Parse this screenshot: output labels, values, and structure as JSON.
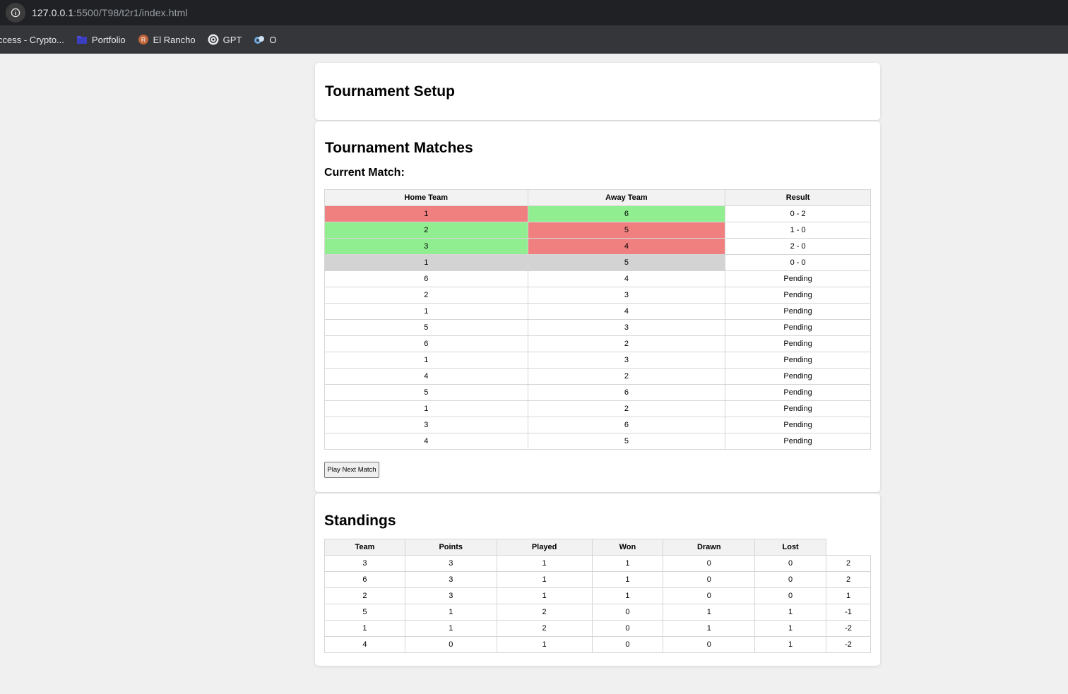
{
  "browser": {
    "url_host": "127.0.0.1",
    "url_rest": ":5500/T98/t2r1/index.html",
    "bookmarks": [
      {
        "label": "ccess - Crypto...",
        "icon": ""
      },
      {
        "label": "Portfolio",
        "icon": "folder-icon"
      },
      {
        "label": "El Rancho",
        "icon": "rancho-icon"
      },
      {
        "label": "GPT",
        "icon": "openai-icon"
      },
      {
        "label": "O",
        "icon": "o-icon"
      }
    ]
  },
  "setup": {
    "title": "Tournament Setup"
  },
  "matches": {
    "title": "Tournament Matches",
    "current_match_label": "Current Match:",
    "headers": [
      "Home Team",
      "Away Team",
      "Result"
    ],
    "rows": [
      {
        "home": "1",
        "away": "6",
        "result": "0 - 2",
        "home_status": "lose",
        "away_status": "win"
      },
      {
        "home": "2",
        "away": "5",
        "result": "1 - 0",
        "home_status": "win",
        "away_status": "lose"
      },
      {
        "home": "3",
        "away": "4",
        "result": "2 - 0",
        "home_status": "win",
        "away_status": "lose"
      },
      {
        "home": "1",
        "away": "5",
        "result": "0 - 0",
        "home_status": "draw",
        "away_status": "draw"
      },
      {
        "home": "6",
        "away": "4",
        "result": "Pending",
        "home_status": "",
        "away_status": ""
      },
      {
        "home": "2",
        "away": "3",
        "result": "Pending",
        "home_status": "",
        "away_status": ""
      },
      {
        "home": "1",
        "away": "4",
        "result": "Pending",
        "home_status": "",
        "away_status": ""
      },
      {
        "home": "5",
        "away": "3",
        "result": "Pending",
        "home_status": "",
        "away_status": ""
      },
      {
        "home": "6",
        "away": "2",
        "result": "Pending",
        "home_status": "",
        "away_status": ""
      },
      {
        "home": "1",
        "away": "3",
        "result": "Pending",
        "home_status": "",
        "away_status": ""
      },
      {
        "home": "4",
        "away": "2",
        "result": "Pending",
        "home_status": "",
        "away_status": ""
      },
      {
        "home": "5",
        "away": "6",
        "result": "Pending",
        "home_status": "",
        "away_status": ""
      },
      {
        "home": "1",
        "away": "2",
        "result": "Pending",
        "home_status": "",
        "away_status": ""
      },
      {
        "home": "3",
        "away": "6",
        "result": "Pending",
        "home_status": "",
        "away_status": ""
      },
      {
        "home": "4",
        "away": "5",
        "result": "Pending",
        "home_status": "",
        "away_status": ""
      }
    ],
    "play_button": "Play Next Match"
  },
  "standings": {
    "title": "Standings",
    "headers": [
      "Team",
      "Points",
      "Played",
      "Won",
      "Drawn",
      "Lost"
    ],
    "rows": [
      [
        "3",
        "3",
        "1",
        "1",
        "0",
        "0",
        "2"
      ],
      [
        "6",
        "3",
        "1",
        "1",
        "0",
        "0",
        "2"
      ],
      [
        "2",
        "3",
        "1",
        "1",
        "0",
        "0",
        "1"
      ],
      [
        "5",
        "1",
        "2",
        "0",
        "1",
        "1",
        "-1"
      ],
      [
        "1",
        "1",
        "2",
        "0",
        "1",
        "1",
        "-2"
      ],
      [
        "4",
        "0",
        "1",
        "0",
        "0",
        "1",
        "-2"
      ]
    ]
  },
  "colors": {
    "win": "#90ee90",
    "lose": "#f08080",
    "draw": "#d3d3d3"
  }
}
